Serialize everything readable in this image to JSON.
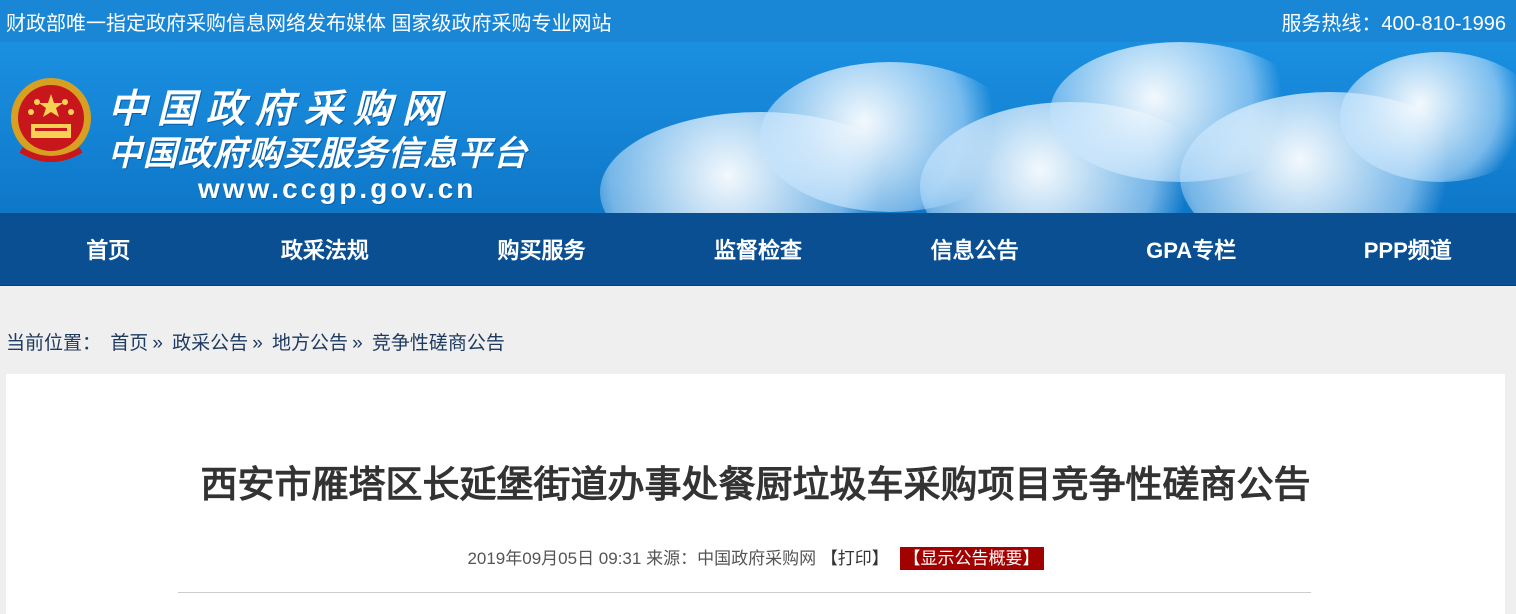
{
  "topbar": {
    "slogan": "财政部唯一指定政府采购信息网络发布媒体 国家级政府采购专业网站",
    "hotline": "服务热线：400-810-1996"
  },
  "banner": {
    "title": "中国政府采购网",
    "subtitle": "中国政府购买服务信息平台",
    "url": "www.ccgp.gov.cn",
    "emblem_icon": "national-emblem"
  },
  "nav": {
    "items": [
      {
        "label": "首页"
      },
      {
        "label": "政采法规"
      },
      {
        "label": "购买服务"
      },
      {
        "label": "监督检查"
      },
      {
        "label": "信息公告"
      },
      {
        "label": "GPA专栏"
      },
      {
        "label": "PPP频道"
      }
    ]
  },
  "breadcrumb": {
    "prefix": "当前位置：",
    "items": [
      {
        "label": "首页",
        "sep": "»"
      },
      {
        "label": "政采公告",
        "sep": "»"
      },
      {
        "label": "地方公告",
        "sep": "»"
      },
      {
        "label": "竞争性磋商公告",
        "sep": ""
      }
    ]
  },
  "article": {
    "title": "西安市雁塔区长延堡街道办事处餐厨垃圾车采购项目竞争性磋商公告",
    "datetime": "2019年09月05日 09:31",
    "source_label": "来源：",
    "source": "中国政府采购网",
    "print_label": "【打印】",
    "summary_label": "【显示公告概要】"
  },
  "colors": {
    "topbar": "#1a86d6",
    "nav": "#0a4f92",
    "summary_badge": "#a30000"
  }
}
